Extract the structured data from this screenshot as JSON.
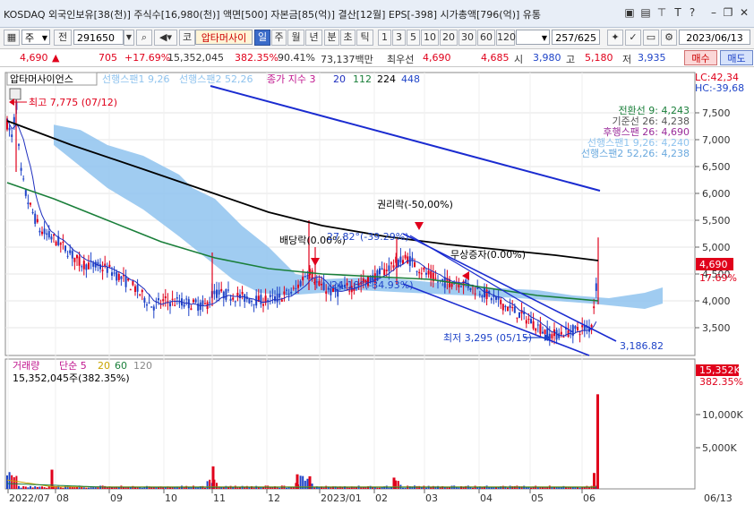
{
  "titlebar": {
    "text": "KOSDAQ 외국인보유[38(천)] 주식수[16,980(천)] 액면[500] 자본금[85(억)] 결산[12월] EPS[-398] 시가총액[796(억)] 유통",
    "icons": [
      "window-icon",
      "bookmark-icon",
      "pin-icon",
      "text-t-icon",
      "help-icon",
      "minimize-icon",
      "restore-icon",
      "close-icon"
    ]
  },
  "toolbar": {
    "type_label": "주",
    "market_label": "전",
    "code": "291650",
    "name_prefix": "코",
    "stock_name": "압타머사이",
    "periods": [
      "일",
      "주",
      "월",
      "년",
      "분",
      "초",
      "틱"
    ],
    "intervals": [
      "1",
      "3",
      "5",
      "10",
      "20",
      "30",
      "60",
      "120"
    ],
    "count": "257",
    "total": "/625",
    "date": "2023/06/13"
  },
  "quote": {
    "price": "4,690",
    "arrow": "▲",
    "change": "705",
    "change_pct": "+17.69%",
    "volume": "15,352,045",
    "volume_ratio": "382.35%",
    "turnover": "90.41%",
    "amount": "73,137백만",
    "ask_label": "최우선",
    "ask": "4,690",
    "bid": "4,685",
    "open_label": "시",
    "open": "3,980",
    "high_label": "고",
    "high": "5,180",
    "low_label": "저",
    "low": "3,935",
    "buy_label": "매수",
    "sell_label": "매도"
  },
  "legend": {
    "stock_name": "압타머사이언스",
    "span1": "선행스팬1 9,26",
    "span2": "선행스팬2 52,26",
    "ma_title": "종가 지수 3",
    "ma20": "20",
    "ma112": "112",
    "ma224": "224",
    "ma448": "448"
  },
  "lc_hc": {
    "lc": "LC:42,34",
    "hc": "HC:-39,68"
  },
  "ichimoku_values": [
    {
      "text": "전환선 9: 4,243",
      "color": "#1a7f3a"
    },
    {
      "text": "기준선 26: 4,238",
      "color": "#555555"
    },
    {
      "text": "후행스팬 26: 4,690",
      "color": "#9a2b9a"
    },
    {
      "text": "선행스팬1 9,26: 4,240",
      "color": "#8fc3ee"
    },
    {
      "text": "선행스팬2 52,26: 4,238",
      "color": "#6aa9de"
    }
  ],
  "annotations": {
    "high": "최고 7,775 (07/12)",
    "dividend": "배당락(0.00%)",
    "rights": "권리락(-50,00%)",
    "bonus": "무상증자(0.00%)",
    "low": "최저 3,295 (05/15)",
    "fib1": "27.82°(-39.29%)",
    "fib2": "24.18°(-34.93%)",
    "trend_end": "3,186.82"
  },
  "price_axis": {
    "ticks": [
      "7,500",
      "7,000",
      "6,500",
      "6,000",
      "5,500",
      "5,000",
      "4,500",
      "4,000",
      "3,500"
    ],
    "current": "4,690",
    "current_pct": "17.69%"
  },
  "volume_legend": {
    "title": "거래량",
    "ma_label": "단순 5",
    "ma20": "20",
    "ma60": "60",
    "ma120": "120",
    "value": "15,352,045주(382.35%)"
  },
  "volume_axis": {
    "ticks": [
      "10,000K",
      "5,000K"
    ],
    "current": "15,352K",
    "current_pct": "382.35%"
  },
  "x_axis": {
    "labels": [
      "2022/07",
      "08",
      "09",
      "10",
      "11",
      "12",
      "2023/01",
      "02",
      "03",
      "04",
      "05",
      "06"
    ],
    "right_label": "06/13"
  },
  "colors": {
    "up": "#e0001b",
    "down": "#1f44c8",
    "cloud": "#8fc3ee",
    "ma_long": "#000000",
    "ma_mid": "#1a7f3a",
    "ma_short": "#1f2fbf",
    "trend": "#1a2bd0"
  }
}
